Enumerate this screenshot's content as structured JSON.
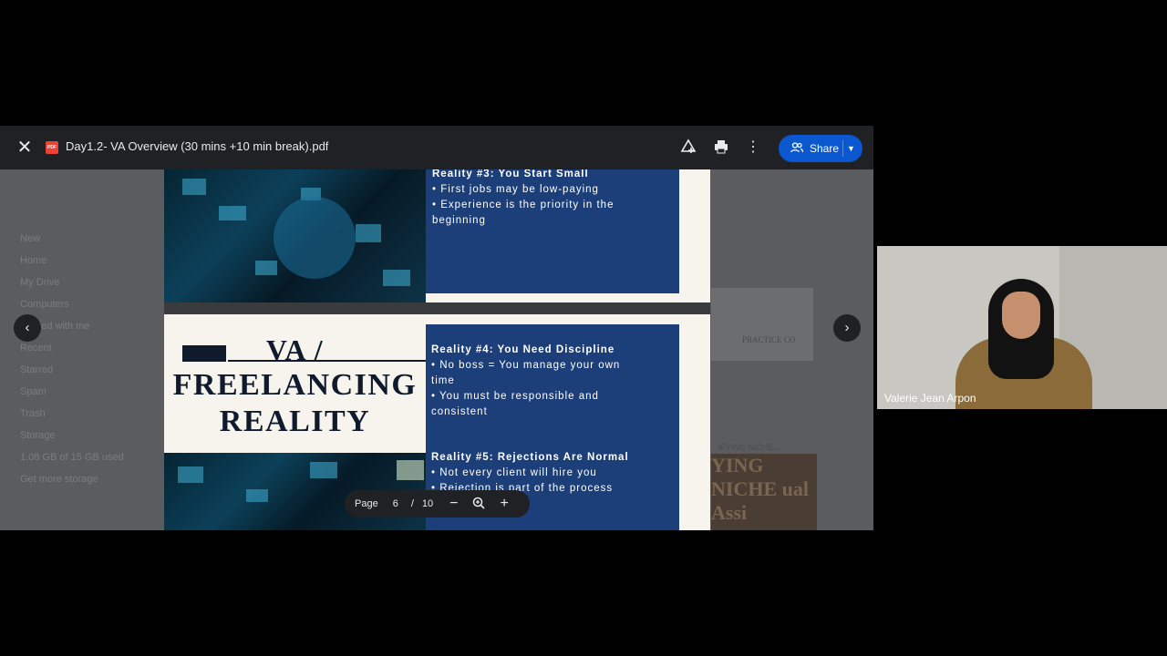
{
  "viewer": {
    "file_name": "Day1.2- VA Overview (30 mins +10 min break).pdf",
    "file_type_badge": "PDF",
    "share_label": "Share"
  },
  "page_control": {
    "label": "Page",
    "current": "6",
    "separator": "/",
    "total": "10"
  },
  "slides": {
    "reality3": {
      "heading": "Reality #3: You Start Small",
      "points": [
        "• First jobs may be low-paying",
        "• Experience is the priority in the",
        "beginning"
      ]
    },
    "title_lines": [
      "VA /",
      "FREELANCING",
      "REALITY"
    ],
    "reality4": {
      "heading": "Reality #4: You Need Discipline",
      "points": [
        "• No boss = You manage your own",
        "time",
        "• You must be responsible and",
        "consistent"
      ]
    },
    "reality5": {
      "heading": "Reality #5: Rejections Are Normal",
      "points": [
        "• Not every client will hire you",
        "• Rejection is part of the process"
      ]
    }
  },
  "drive_background": {
    "sidebar": [
      "New",
      "Home",
      "My Drive",
      "Computers",
      "Shared with me",
      "Recent",
      "Starred",
      "Spam",
      "Trash",
      "Storage",
      "1.08 GB of 15 GB used",
      "Get more storage"
    ],
    "thumb_text": "PRACTICE CO",
    "file_label": "IFYING NICHE...",
    "thumb2_text": "YING NICHE ual Assi"
  },
  "webcam": {
    "participant_name": "Valerie Jean Arpon"
  }
}
